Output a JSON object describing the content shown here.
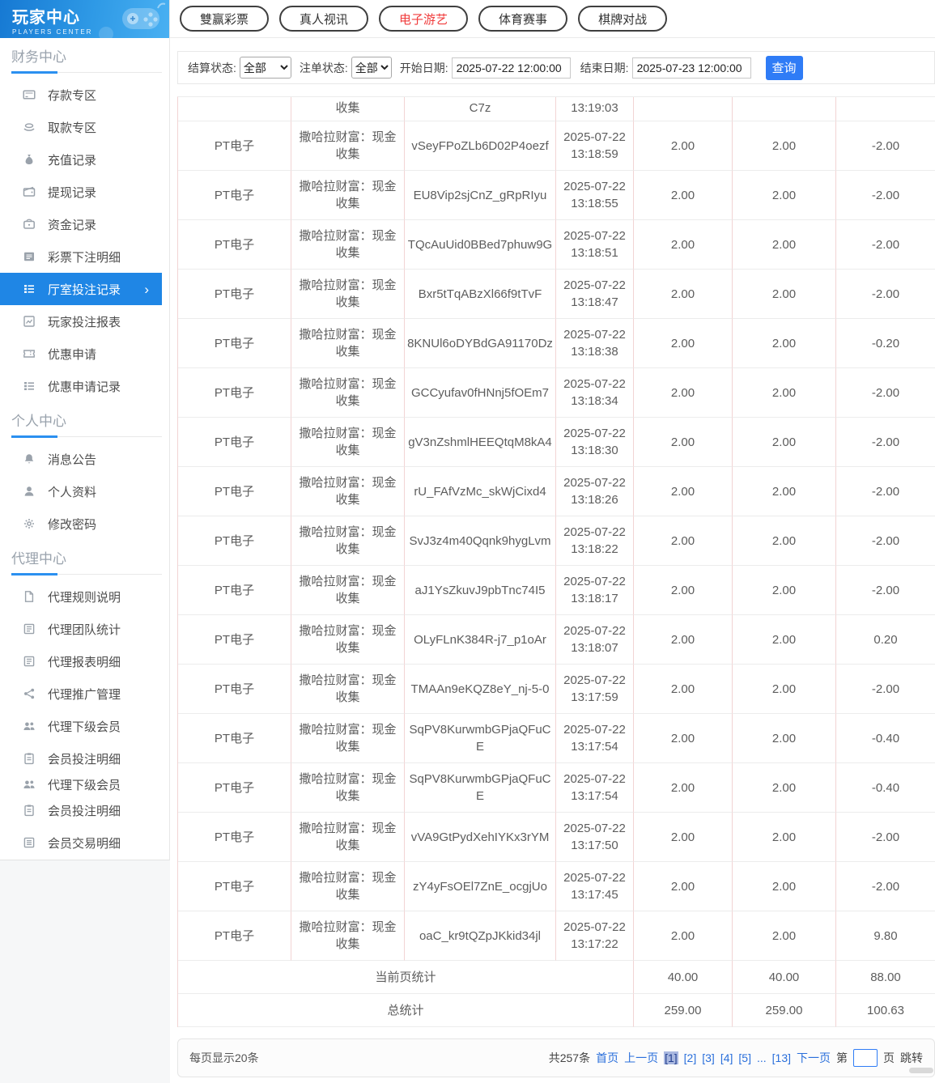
{
  "colors": {
    "accent_blue": "#2b90f0",
    "sidebar_active_bg": "#1f86e5",
    "button_blue": "#2f7cf6",
    "tab_active_red": "#f03b3b",
    "link_blue": "#2a6fdb",
    "page_current_bg": "#a9b8e0",
    "table_divider_pink": "#f2d4d4",
    "side_below_bg": "#f6f7f8"
  },
  "sidebar": {
    "title": "玩家中心",
    "subtitle": "PLAYERS CENTER",
    "sections": [
      {
        "title": "财务中心",
        "items": [
          {
            "label": "存款专区",
            "icon": "deposit-card-icon"
          },
          {
            "label": "取款专区",
            "icon": "withdraw-hand-icon"
          },
          {
            "label": "充值记录",
            "icon": "moneybag-icon"
          },
          {
            "label": "提现记录",
            "icon": "wallet-icon"
          },
          {
            "label": "资金记录",
            "icon": "purse-icon"
          },
          {
            "label": "彩票下注明细",
            "icon": "list-icon"
          },
          {
            "label": "厅室投注记录",
            "icon": "list-check-icon",
            "active": true,
            "chevron": "›"
          },
          {
            "label": "玩家投注报表",
            "icon": "chart-icon"
          },
          {
            "label": "优惠申请",
            "icon": "coupon-icon"
          },
          {
            "label": "优惠申请记录",
            "icon": "list-check-icon"
          }
        ]
      },
      {
        "title": "个人中心",
        "items": [
          {
            "label": "消息公告",
            "icon": "bell-icon"
          },
          {
            "label": "个人资料",
            "icon": "person-icon"
          },
          {
            "label": "修改密码",
            "icon": "gear-icon"
          }
        ]
      },
      {
        "title": "代理中心",
        "items": [
          {
            "label": "代理规则说明",
            "icon": "document-icon"
          },
          {
            "label": "代理团队统计",
            "icon": "report-icon"
          },
          {
            "label": "代理报表明细",
            "icon": "report-icon"
          },
          {
            "label": "代理推广管理",
            "icon": "share-icon"
          },
          {
            "label": "代理下级会员",
            "icon": "people-icon"
          },
          {
            "label": "会员投注明细",
            "icon": "clipboard-icon"
          },
          {
            "label": "代理下级会员",
            "icon": "people-icon",
            "tight": true
          },
          {
            "label": "会员投注明细",
            "icon": "clipboard-icon"
          },
          {
            "label": "会员交易明细",
            "icon": "list-alt-icon"
          }
        ]
      }
    ]
  },
  "tabs": [
    {
      "label": "雙赢彩票",
      "active": false
    },
    {
      "label": "真人视讯",
      "active": false
    },
    {
      "label": "电子游艺",
      "active": true
    },
    {
      "label": "体育赛事",
      "active": false
    },
    {
      "label": "棋牌对战",
      "active": false
    }
  ],
  "filters": {
    "settle_status_label": "结算状态:",
    "settle_status_value": "全部",
    "order_status_label": "注单状态:",
    "order_status_value": "全部",
    "start_date_label": "开始日期:",
    "start_date_value": "2025-07-22 12:00:00",
    "end_date_label": "结束日期:",
    "end_date_value": "2025-07-23 12:00:00",
    "query_button": "查询"
  },
  "table": {
    "partial_row": {
      "game_name_tail": "收集",
      "order_tail": "C7z",
      "time_tail": "13:19:03"
    },
    "rows": [
      {
        "platform": "PT电子",
        "game": "撒哈拉财富：现金收集",
        "order": "vSeyFPoZLb6D02P4oezf",
        "time": "2025-07-22 13:18:59",
        "bet": "2.00",
        "valid": "2.00",
        "result": "-2.00"
      },
      {
        "platform": "PT电子",
        "game": "撒哈拉财富：现金收集",
        "order": "EU8Vip2sjCnZ_gRpRIyu",
        "time": "2025-07-22 13:18:55",
        "bet": "2.00",
        "valid": "2.00",
        "result": "-2.00"
      },
      {
        "platform": "PT电子",
        "game": "撒哈拉财富：现金收集",
        "order": "TQcAuUid0BBed7phuw9G",
        "time": "2025-07-22 13:18:51",
        "bet": "2.00",
        "valid": "2.00",
        "result": "-2.00"
      },
      {
        "platform": "PT电子",
        "game": "撒哈拉财富：现金收集",
        "order": "Bxr5tTqABzXl66f9tTvF",
        "time": "2025-07-22 13:18:47",
        "bet": "2.00",
        "valid": "2.00",
        "result": "-2.00"
      },
      {
        "platform": "PT电子",
        "game": "撒哈拉财富：现金收集",
        "order": "8KNUl6oDYBdGA91170Dz",
        "time": "2025-07-22 13:18:38",
        "bet": "2.00",
        "valid": "2.00",
        "result": "-0.20"
      },
      {
        "platform": "PT电子",
        "game": "撒哈拉财富：现金收集",
        "order": "GCCyufav0fHNnj5fOEm7",
        "time": "2025-07-22 13:18:34",
        "bet": "2.00",
        "valid": "2.00",
        "result": "-2.00"
      },
      {
        "platform": "PT电子",
        "game": "撒哈拉财富：现金收集",
        "order": "gV3nZshmlHEEQtqM8kA4",
        "time": "2025-07-22 13:18:30",
        "bet": "2.00",
        "valid": "2.00",
        "result": "-2.00"
      },
      {
        "platform": "PT电子",
        "game": "撒哈拉财富：现金收集",
        "order": "rU_FAfVzMc_skWjCixd4",
        "time": "2025-07-22 13:18:26",
        "bet": "2.00",
        "valid": "2.00",
        "result": "-2.00"
      },
      {
        "platform": "PT电子",
        "game": "撒哈拉财富：现金收集",
        "order": "SvJ3z4m40Qqnk9hygLvm",
        "time": "2025-07-22 13:18:22",
        "bet": "2.00",
        "valid": "2.00",
        "result": "-2.00"
      },
      {
        "platform": "PT电子",
        "game": "撒哈拉财富：现金收集",
        "order": "aJ1YsZkuvJ9pbTnc74I5",
        "time": "2025-07-22 13:18:17",
        "bet": "2.00",
        "valid": "2.00",
        "result": "-2.00"
      },
      {
        "platform": "PT电子",
        "game": "撒哈拉财富：现金收集",
        "order": "OLyFLnK384R-j7_p1oAr",
        "time": "2025-07-22 13:18:07",
        "bet": "2.00",
        "valid": "2.00",
        "result": "0.20"
      },
      {
        "platform": "PT电子",
        "game": "撒哈拉财富：现金收集",
        "order": "TMAAn9eKQZ8eY_nj-5-0",
        "time": "2025-07-22 13:17:59",
        "bet": "2.00",
        "valid": "2.00",
        "result": "-2.00"
      },
      {
        "platform": "PT电子",
        "game": "撒哈拉财富：现金收集",
        "order": "SqPV8KurwmbGPjaQFuCE",
        "time": "2025-07-22 13:17:54",
        "bet": "2.00",
        "valid": "2.00",
        "result": "-0.40"
      },
      {
        "platform": "PT电子",
        "game": "撒哈拉财富：现金收集",
        "order": "SqPV8KurwmbGPjaQFuCE",
        "time": "2025-07-22 13:17:54",
        "bet": "2.00",
        "valid": "2.00",
        "result": "-0.40"
      },
      {
        "platform": "PT电子",
        "game": "撒哈拉财富：现金收集",
        "order": "vVA9GtPydXehIYKx3rYM",
        "time": "2025-07-22 13:17:50",
        "bet": "2.00",
        "valid": "2.00",
        "result": "-2.00"
      },
      {
        "platform": "PT电子",
        "game": "撒哈拉财富：现金收集",
        "order": "zY4yFsOEl7ZnE_ocgjUo",
        "time": "2025-07-22 13:17:45",
        "bet": "2.00",
        "valid": "2.00",
        "result": "-2.00"
      },
      {
        "platform": "PT电子",
        "game": "撒哈拉财富：现金收集",
        "order": "oaC_kr9tQZpJKkid34jl",
        "time": "2025-07-22 13:17:22",
        "bet": "2.00",
        "valid": "2.00",
        "result": "9.80"
      }
    ],
    "page_summary": {
      "label": "当前页统计",
      "bet": "40.00",
      "valid": "40.00",
      "result": "88.00"
    },
    "total_summary": {
      "label": "总统计",
      "bet": "259.00",
      "valid": "259.00",
      "result": "100.63"
    }
  },
  "pagination": {
    "page_size_text": "每页显示20条",
    "total_text": "共257条",
    "first_label": "首页",
    "prev_label": "上一页",
    "pages": [
      {
        "label": "[1]",
        "current": true
      },
      {
        "label": "[2]"
      },
      {
        "label": "[3]"
      },
      {
        "label": "[4]"
      },
      {
        "label": "[5]"
      },
      {
        "label": "...",
        "ellipsis": true
      },
      {
        "label": "[13]"
      }
    ],
    "next_label": "下一页",
    "jump_prefix": "第",
    "jump_suffix": "页",
    "jump_button": "跳转"
  }
}
